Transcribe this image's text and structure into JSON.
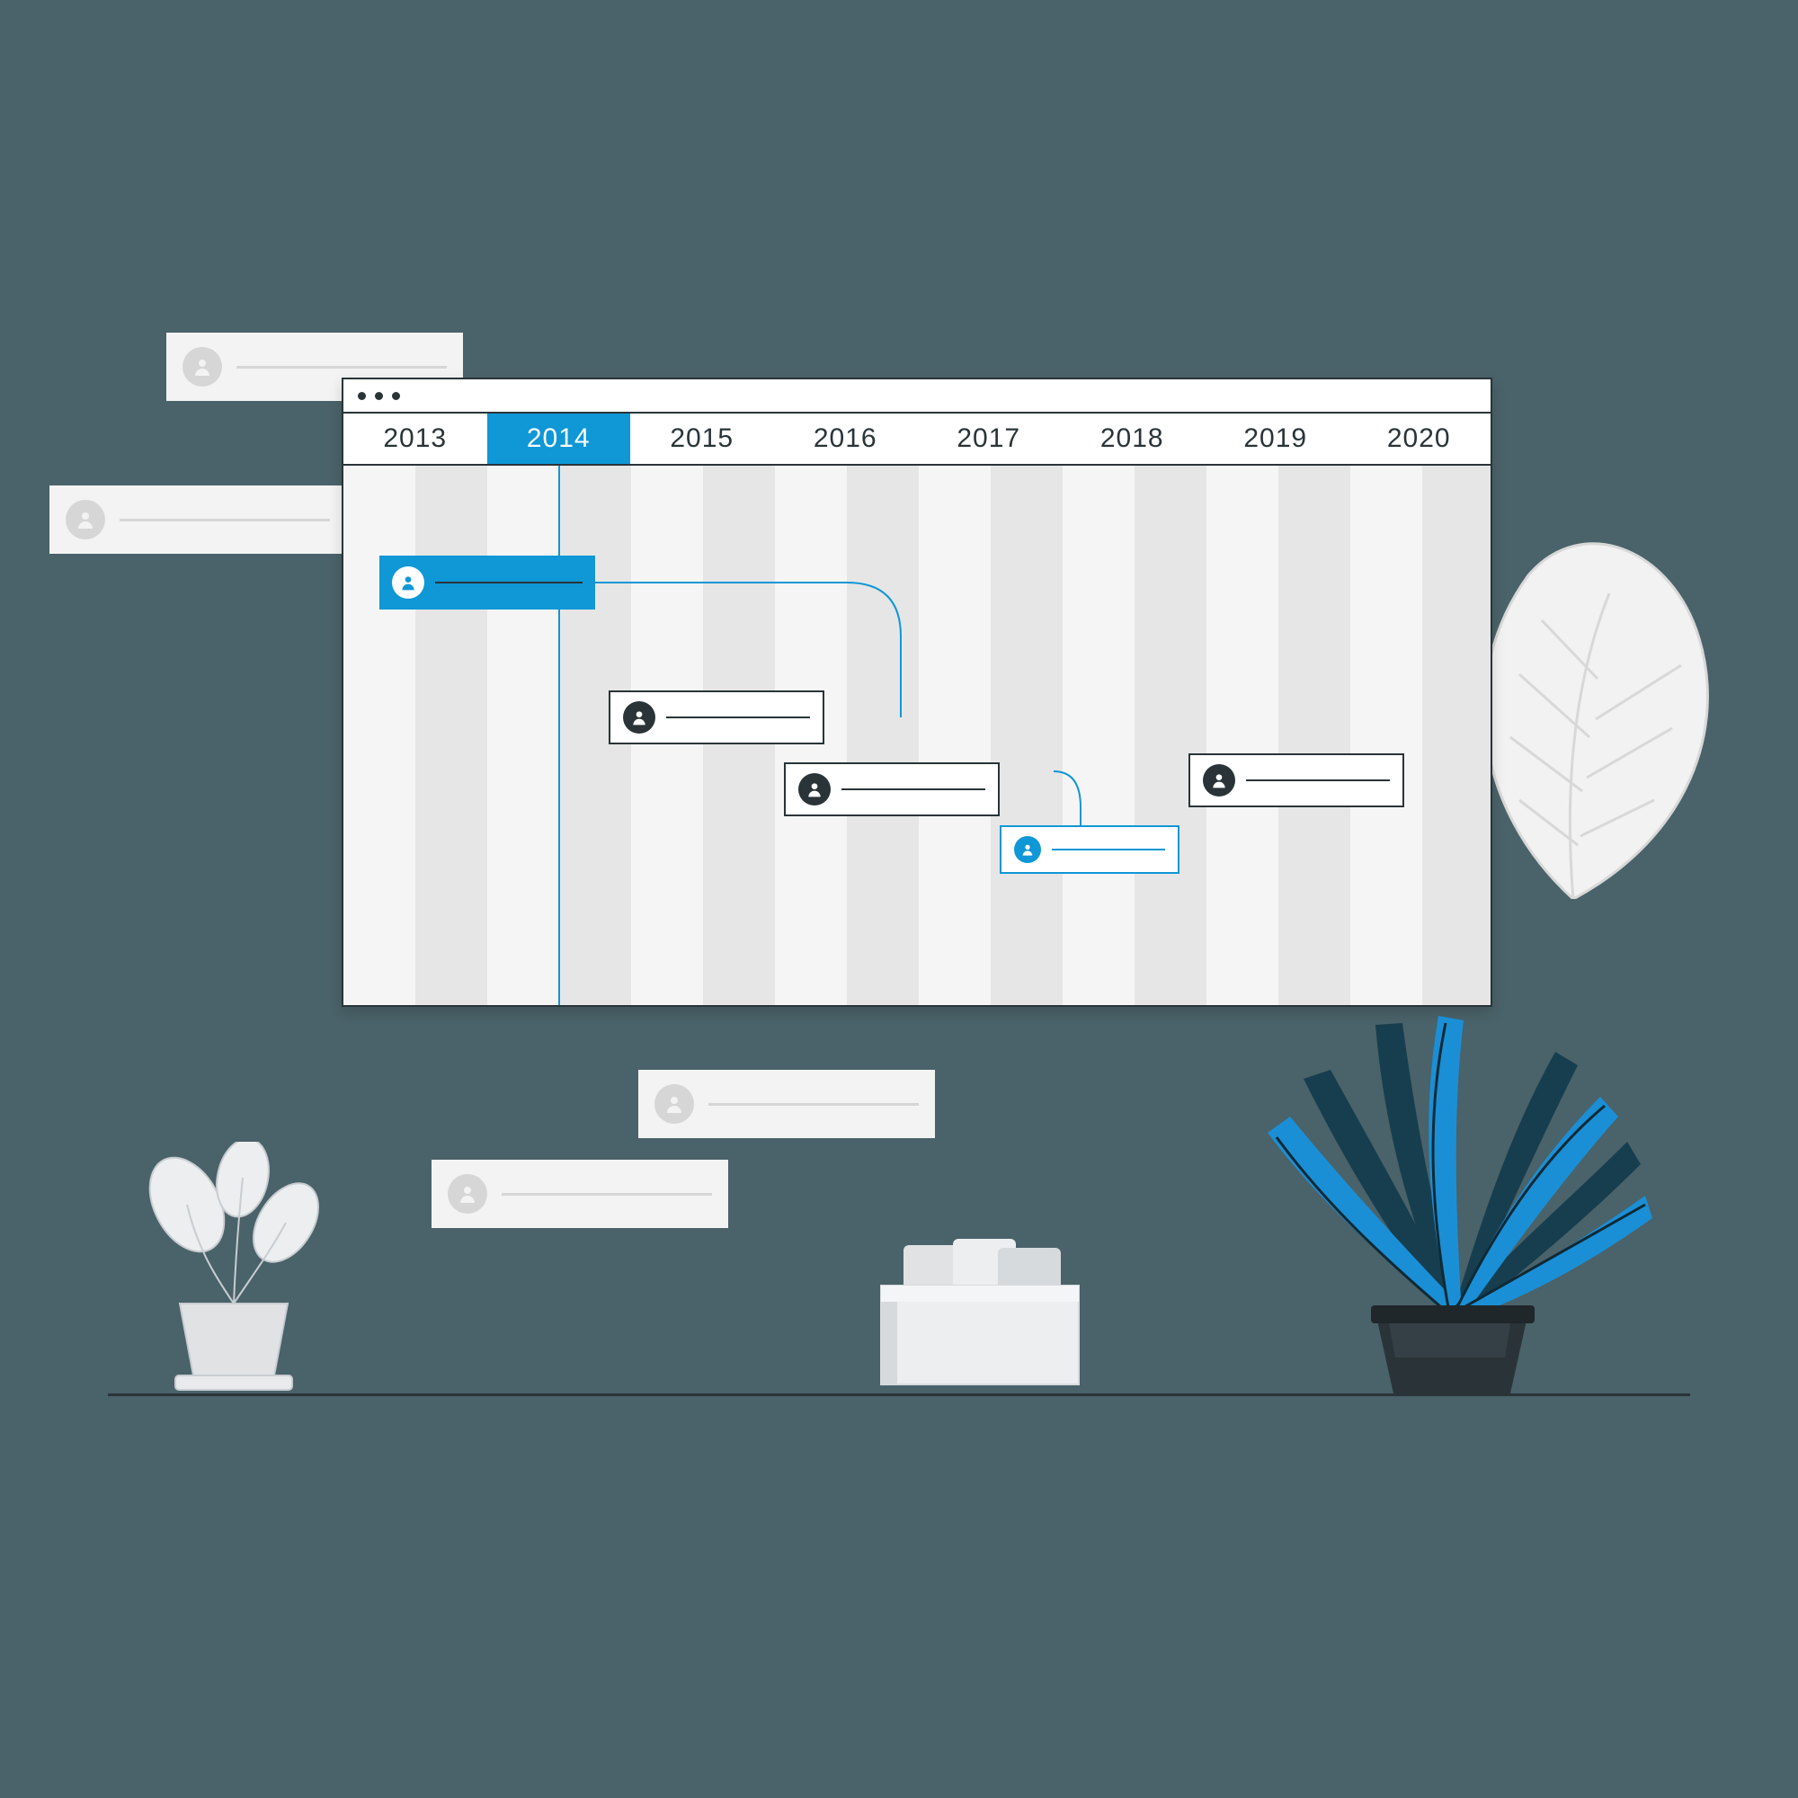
{
  "timeline": {
    "years": [
      "2013",
      "2014",
      "2015",
      "2016",
      "2017",
      "2018",
      "2019",
      "2020"
    ],
    "active_year_index": 1,
    "entries": [
      {
        "id": "a",
        "style": "blue"
      },
      {
        "id": "b",
        "style": "white"
      },
      {
        "id": "c",
        "style": "white"
      },
      {
        "id": "d",
        "style": "cyan-outline"
      },
      {
        "id": "e",
        "style": "white"
      }
    ]
  },
  "colors": {
    "accent": "#0f97d6",
    "dark": "#2a3438",
    "bg": "#4a6269"
  }
}
